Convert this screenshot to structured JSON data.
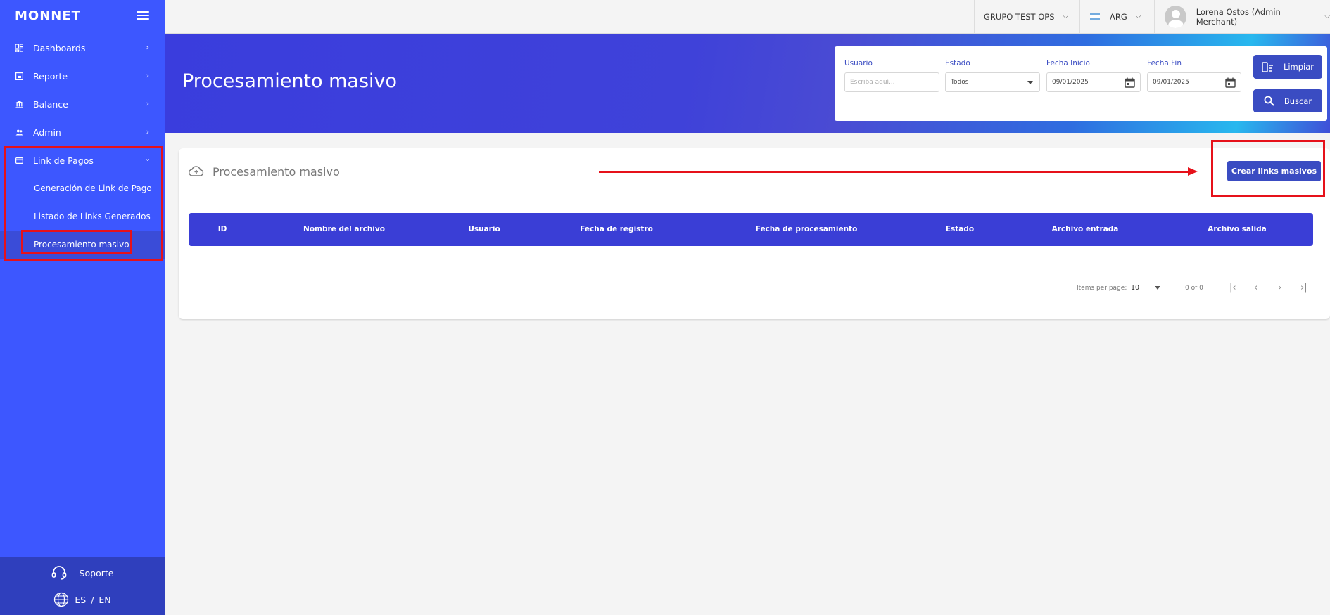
{
  "brand": {
    "logo": "MONNET"
  },
  "sidebar": {
    "items": [
      {
        "label": "Dashboards",
        "icon": "dashboard-icon"
      },
      {
        "label": "Reporte",
        "icon": "report-icon"
      },
      {
        "label": "Balance",
        "icon": "bank-icon"
      },
      {
        "label": "Admin",
        "icon": "users-icon"
      },
      {
        "label": "Link de Pagos",
        "icon": "card-icon",
        "expanded": true
      }
    ],
    "subitems": [
      {
        "label": "Generación de Link de Pago"
      },
      {
        "label": "Listado de Links Generados"
      },
      {
        "label": "Procesamiento masivo",
        "active": true
      }
    ],
    "footer": {
      "support": "Soporte",
      "lang_es": "ES",
      "lang_sep": "/",
      "lang_en": "EN"
    }
  },
  "topbar": {
    "group": "GRUPO TEST OPS",
    "country": "ARG",
    "user": "Lorena Ostos (Admin Merchant)"
  },
  "header": {
    "title": "Procesamiento masivo"
  },
  "filters": {
    "usuario_label": "Usuario",
    "usuario_placeholder": "Escriba aquí...",
    "estado_label": "Estado",
    "estado_value": "Todos",
    "fecha_inicio_label": "Fecha Inicio",
    "fecha_inicio_value": "09/01/2025",
    "fecha_fin_label": "Fecha Fin",
    "fecha_fin_value": "09/01/2025",
    "limpiar": "Limpiar",
    "buscar": "Buscar"
  },
  "card": {
    "title": "Procesamiento masivo",
    "create_button": "Crear links masivos",
    "columns": [
      "ID",
      "Nombre del archivo",
      "Usuario",
      "Fecha de registro",
      "Fecha de procesamiento",
      "Estado",
      "Archivo entrada",
      "Archivo salida"
    ],
    "rows": []
  },
  "pagination": {
    "items_per_page_label": "Items per page:",
    "items_per_page": "10",
    "range": "0 of 0"
  },
  "colors": {
    "sidebar": "#3d57ff",
    "primary": "#3a4cc2",
    "highlight": "#e6111a"
  }
}
